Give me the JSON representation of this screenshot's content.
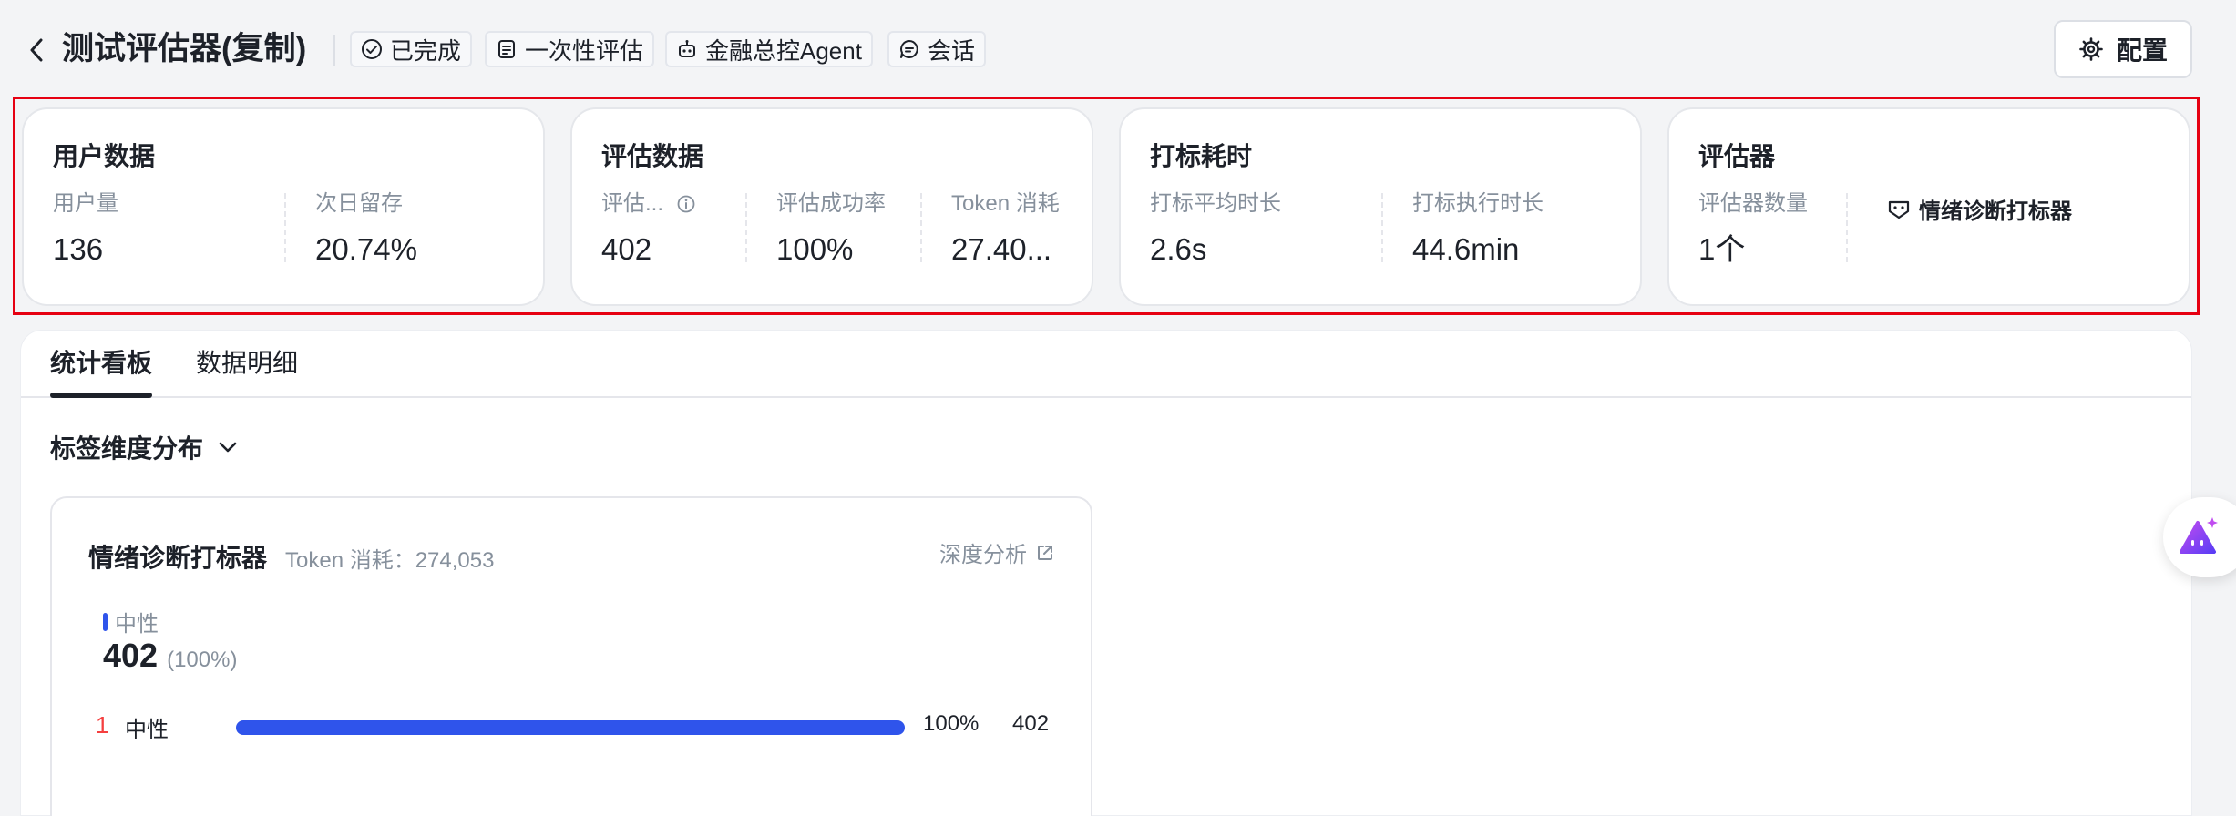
{
  "header": {
    "title": "测试评估器(复制)",
    "tags": [
      {
        "icon": "check-circle-icon",
        "label": "已完成"
      },
      {
        "icon": "list-doc-icon",
        "label": "一次性评估"
      },
      {
        "icon": "robot-icon",
        "label": "金融总控Agent"
      },
      {
        "icon": "chat-bubble-icon",
        "label": "会话"
      }
    ],
    "config_label": "配置"
  },
  "stats": {
    "user": {
      "title": "用户数据",
      "metrics": [
        {
          "label": "用户量",
          "value": "136"
        },
        {
          "label": "次日留存",
          "value": "20.74%"
        }
      ]
    },
    "evaluation": {
      "title": "评估数据",
      "metrics": [
        {
          "label": "评估...",
          "value": "402"
        },
        {
          "label": "评估成功率",
          "value": "100%"
        },
        {
          "label": "Token 消耗",
          "value": "27.40..."
        }
      ]
    },
    "labeling": {
      "title": "打标耗时",
      "metrics": [
        {
          "label": "打标平均时长",
          "value": "2.6s"
        },
        {
          "label": "打标执行时长",
          "value": "44.6min"
        }
      ]
    },
    "evaluator": {
      "title": "评估器",
      "metrics": [
        {
          "label": "评估器数量",
          "value": "1个"
        }
      ],
      "chip_label": "情绪诊断打标器"
    }
  },
  "tabs": [
    {
      "label": "统计看板",
      "active": true
    },
    {
      "label": "数据明细",
      "active": false
    }
  ],
  "dimension_dropdown": {
    "label": "标签维度分布"
  },
  "chart_card": {
    "title": "情绪诊断打标器",
    "token_text": "Token 消耗：274,053",
    "deep_analysis_label": "深度分析",
    "legend_label": "中性",
    "total_count": "402",
    "total_pct": "(100%)"
  },
  "chart_data": {
    "type": "bar",
    "title": "情绪诊断打标器",
    "categories": [
      "中性"
    ],
    "values": [
      402
    ],
    "percentages": [
      "100%"
    ],
    "ranks": [
      "1"
    ],
    "percent_values": [
      100
    ]
  },
  "colors": {
    "accent": "#2f54eb",
    "rank_red": "#f53f3f",
    "highlight_border": "#e60012",
    "text_primary": "#1d2129",
    "text_secondary": "#86909c"
  }
}
